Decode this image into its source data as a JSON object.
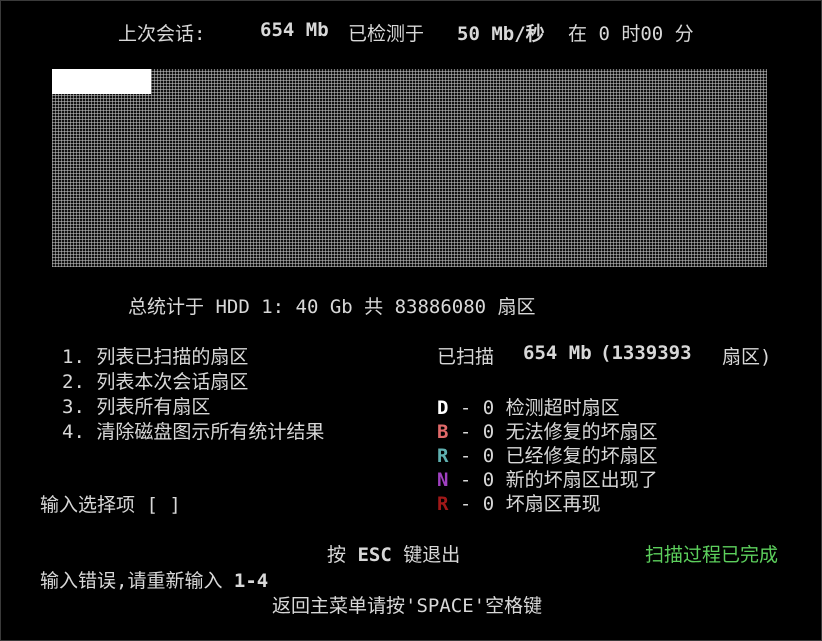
{
  "header": {
    "label_last_session": "上次会话:",
    "session_size": "654 Mb",
    "label_tested_at": "已检测于",
    "speed": "50 Mb/秒",
    "time": "在 0 时00 分"
  },
  "sector_map": {
    "scanned_fraction": 0.016
  },
  "stats": {
    "summary": "总统计于 HDD 1: 40 Gb 共 83886080 扇区"
  },
  "menu": {
    "items": [
      "1. 列表已扫描的扇区",
      "2. 列表本次会话扇区",
      "3. 列表所有扇区",
      "4. 清除磁盘图示所有统计结果"
    ],
    "prompt": "输入选择项 [ ]"
  },
  "scan": {
    "label": "已扫描",
    "size": "654 Mb",
    "sectors": "(1339393",
    "unit": "扇区)"
  },
  "legend": [
    {
      "key": "D",
      "text": "- 0 检测超时扇区",
      "color": "#ffffff"
    },
    {
      "key": "B",
      "text": "- 0 无法修复的坏扇区",
      "color": "#e06a6a"
    },
    {
      "key": "R",
      "text": "- 0 已经修复的坏扇区",
      "color": "#5fb0b0"
    },
    {
      "key": "N",
      "text": "- 0 新的坏扇区出现了",
      "color": "#a040c0"
    },
    {
      "key": "R",
      "text": "- 0 坏扇区再现",
      "color": "#a01818"
    }
  ],
  "footer": {
    "esc_prefix": "按",
    "esc_key": "ESC",
    "esc_suffix": "键退出",
    "status": "扫描过程已完成",
    "status_color": "#5ccf5c",
    "error": "输入错误,请重新输入",
    "error_range": "1-4",
    "return_hint": "返回主菜单请按'SPACE'空格键"
  }
}
